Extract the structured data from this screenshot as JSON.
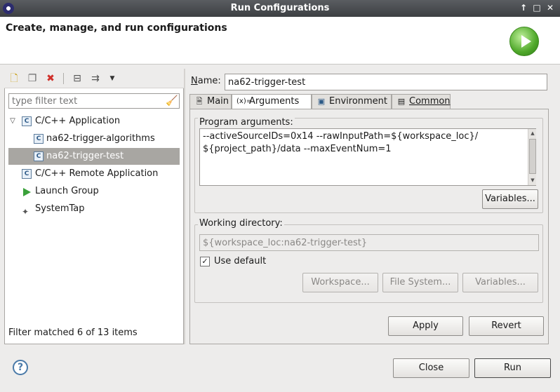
{
  "window": {
    "title": "Run Configurations",
    "controls": {
      "up": "↑",
      "maximize": "□",
      "close": "✕"
    }
  },
  "header": {
    "title": "Create, manage, and run configurations",
    "icon": "run-banner-icon"
  },
  "sidebar": {
    "toolbar": [
      "new-config-icon",
      "duplicate-icon",
      "delete-icon",
      "collapse-all-icon",
      "filter-icon",
      "view-menu-icon"
    ],
    "filter_placeholder": "type filter text",
    "tree": [
      {
        "label": "C/C++ Application",
        "expanded": true,
        "icon": "c-app-icon"
      },
      {
        "label": "na62-trigger-algorithms",
        "icon": "c-config-icon"
      },
      {
        "label": "na62-trigger-test",
        "selected": true,
        "icon": "c-config-icon"
      },
      {
        "label": "C/C++ Remote Application",
        "icon": "c-app-icon"
      },
      {
        "label": "Launch Group",
        "icon": "launch-group-icon"
      },
      {
        "label": "SystemTap",
        "icon": "systemtap-icon"
      }
    ],
    "status": "Filter matched 6 of 13 items"
  },
  "editor": {
    "name_label": "Name:",
    "name_label_mnemonic": "N",
    "name_label_rest": "ame:",
    "name_value": "na62-trigger-test",
    "tabs": [
      {
        "label": "Main",
        "icon": "main-tab-icon"
      },
      {
        "label": "Arguments",
        "icon": "arguments-tab-icon",
        "active": true
      },
      {
        "label": "Environment",
        "icon": "environment-tab-icon"
      },
      {
        "label": "Common",
        "icon": "common-tab-icon"
      }
    ],
    "program_arguments_label": "Program arguments:",
    "program_arguments": "--activeSourceIDs=0x14 --rawInputPath=${workspace_loc}/\n${project_path}/data --maxEventNum=1",
    "variables_button": "Variables...",
    "working_directory_label": "Working directory:",
    "working_directory": "${workspace_loc:na62-trigger-test}",
    "use_default_label": "Use default",
    "use_default_checked": true,
    "workspace_button": "Workspace...",
    "file_system_button": "File System...",
    "variables_button_2": "Variables...",
    "apply_button": "Apply",
    "revert_button": "Revert"
  },
  "footer": {
    "help_icon": "help-icon",
    "close_button": "Close",
    "run_button": "Run"
  }
}
